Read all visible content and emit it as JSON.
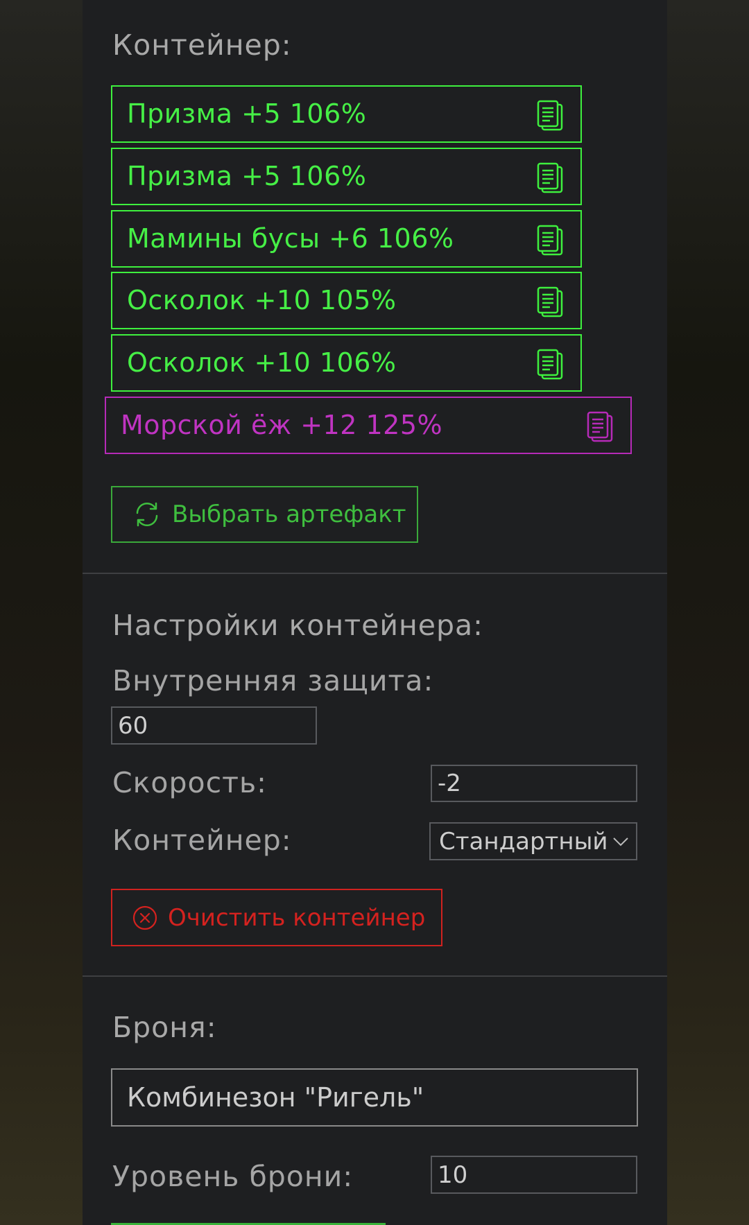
{
  "container_section": {
    "title": "Контейнер:",
    "artifacts": [
      {
        "label": "Призма +5 106%",
        "rarity": "green"
      },
      {
        "label": "Призма +5 106%",
        "rarity": "green"
      },
      {
        "label": "Мамины бусы +6 106%",
        "rarity": "green"
      },
      {
        "label": "Осколок +10 105%",
        "rarity": "green"
      },
      {
        "label": "Осколок +10 106%",
        "rarity": "green"
      },
      {
        "label": "Морской ёж +12 125%",
        "rarity": "purple"
      }
    ],
    "choose_button": "Выбрать артефакт"
  },
  "settings": {
    "title": "Настройки контейнера:",
    "inner_protection_label": "Внутренняя защита:",
    "inner_protection_value": "60",
    "speed_label": "Скорость:",
    "speed_value": "-2",
    "container_label": "Контейнер:",
    "container_type": "Стандартный",
    "clear_button": "Очистить контейнер"
  },
  "armor": {
    "title": "Броня:",
    "name": "Комбинезон \"Ригель\"",
    "level_label": "Уровень брони:",
    "level_value": "10"
  },
  "colors": {
    "panel": "#1e1f21",
    "green": "#46ef46",
    "purple": "#c034c2",
    "red": "#d4221f",
    "text_muted": "#a9a9a9"
  },
  "icons": {
    "copy": "copy-icon",
    "refresh": "refresh-icon",
    "clear": "close-circle-icon",
    "dropdown": "chevron-down-icon"
  }
}
